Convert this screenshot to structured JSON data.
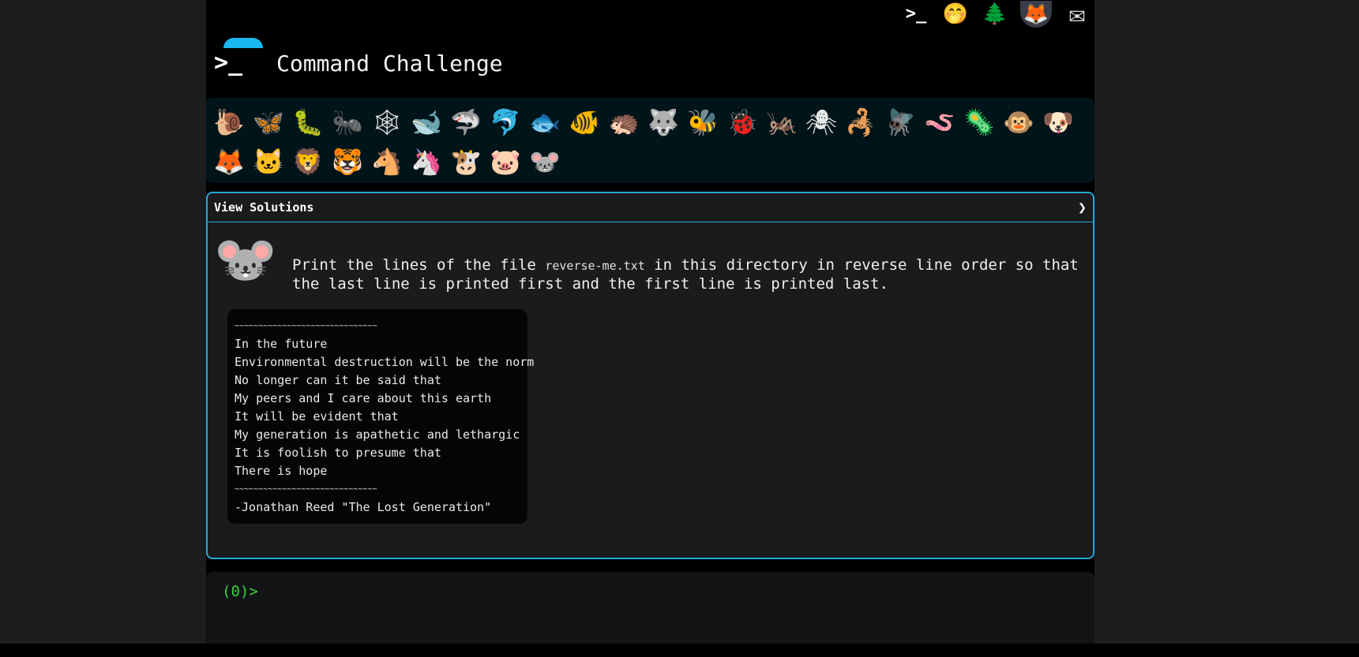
{
  "header": {
    "title": "Command Challenge",
    "top_icons": [
      {
        "name": "terminal-icon",
        "glyph": ">_"
      },
      {
        "name": "shush-face-icon",
        "glyph": "🤭"
      },
      {
        "name": "tree-icon",
        "glyph": "🌲"
      },
      {
        "name": "gitlab-icon",
        "glyph": "🦊"
      },
      {
        "name": "mail-icon",
        "glyph": "✉"
      }
    ]
  },
  "animals": [
    {
      "name": "snail",
      "glyph": "🐌"
    },
    {
      "name": "butterfly",
      "glyph": "🦋"
    },
    {
      "name": "caterpillar",
      "glyph": "🐛"
    },
    {
      "name": "ant",
      "glyph": "🐜"
    },
    {
      "name": "spider-web",
      "glyph": "🕸"
    },
    {
      "name": "whale",
      "glyph": "🐋"
    },
    {
      "name": "shark",
      "glyph": "🦈"
    },
    {
      "name": "dolphin",
      "glyph": "🐬"
    },
    {
      "name": "fish",
      "glyph": "🐟"
    },
    {
      "name": "tropical-fish",
      "glyph": "🐠"
    },
    {
      "name": "hedgehog",
      "glyph": "🦔"
    },
    {
      "name": "wolf",
      "glyph": "🐺"
    },
    {
      "name": "bee",
      "glyph": "🐝"
    },
    {
      "name": "ladybug",
      "glyph": "🐞"
    },
    {
      "name": "cricket",
      "glyph": "🦗"
    },
    {
      "name": "spider",
      "glyph": "🕷"
    },
    {
      "name": "scorpion",
      "glyph": "🦂"
    },
    {
      "name": "fly",
      "glyph": "🪰"
    },
    {
      "name": "worm",
      "glyph": "🪱"
    },
    {
      "name": "microbe",
      "glyph": "🦠"
    },
    {
      "name": "monkey",
      "glyph": "🐵"
    },
    {
      "name": "dog",
      "glyph": "🐶"
    },
    {
      "name": "fox",
      "glyph": "🦊"
    },
    {
      "name": "cat",
      "glyph": "🐱"
    },
    {
      "name": "lion",
      "glyph": "🦁"
    },
    {
      "name": "tiger",
      "glyph": "🐯"
    },
    {
      "name": "horse",
      "glyph": "🐴"
    },
    {
      "name": "unicorn",
      "glyph": "🦄"
    },
    {
      "name": "cow",
      "glyph": "🐮"
    },
    {
      "name": "pig",
      "glyph": "🐷"
    },
    {
      "name": "mouse",
      "glyph": "🐭"
    }
  ],
  "panel": {
    "head_label": "View Solutions",
    "chevron": "❯",
    "avatar_glyph": "🐭",
    "prompt_before": "Print the lines of the file ",
    "prompt_file": "reverse-me.txt",
    "prompt_after": " in this directory in reverse line order so that the last line is printed first and the first line is printed last.",
    "poem_lines": [
      "~~~~~~~~~~~~~~~~~~~~~~~~~~~~~~",
      "In the future",
      "Environmental destruction will be the norm",
      "No longer can it be said that",
      "My peers and I care about this earth",
      "It will be evident that",
      "My generation is apathetic and lethargic",
      "It is foolish to presume that",
      "There is hope",
      "~~~~~~~~~~~~~~~~~~~~~~~~~~~~~~",
      "-Jonathan Reed \"The Lost Generation\""
    ]
  },
  "terminal": {
    "prompt": "(0)>"
  }
}
